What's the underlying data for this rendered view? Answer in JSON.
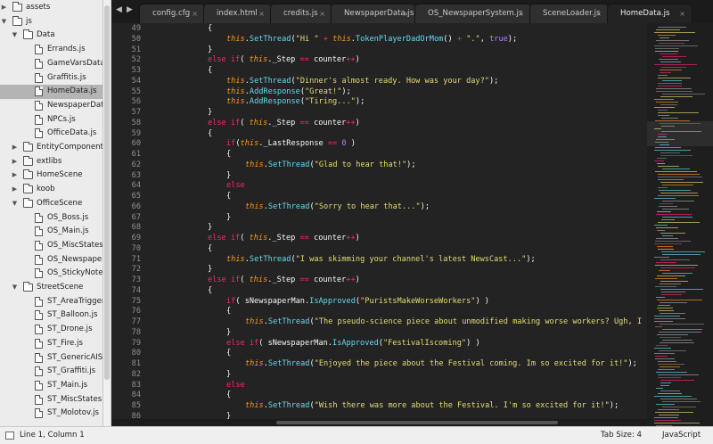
{
  "sidebar": {
    "items": [
      {
        "label": "assets",
        "type": "folder",
        "depth": 0,
        "open": false
      },
      {
        "label": "js",
        "type": "folder",
        "depth": 0,
        "open": true
      },
      {
        "label": "Data",
        "type": "folder",
        "depth": 1,
        "open": true
      },
      {
        "label": "Errands.js",
        "type": "file",
        "depth": 2
      },
      {
        "label": "GameVarsData",
        "type": "file",
        "depth": 2
      },
      {
        "label": "Graffitis.js",
        "type": "file",
        "depth": 2
      },
      {
        "label": "HomeData.js",
        "type": "file",
        "depth": 2,
        "selected": true
      },
      {
        "label": "NewspaperDat",
        "type": "file",
        "depth": 2
      },
      {
        "label": "NPCs.js",
        "type": "file",
        "depth": 2
      },
      {
        "label": "OfficeData.js",
        "type": "file",
        "depth": 2
      },
      {
        "label": "EntityComponent",
        "type": "folder",
        "depth": 1,
        "open": false
      },
      {
        "label": "extlibs",
        "type": "folder",
        "depth": 1,
        "open": false
      },
      {
        "label": "HomeScene",
        "type": "folder",
        "depth": 1,
        "open": false
      },
      {
        "label": "koob",
        "type": "folder",
        "depth": 1,
        "open": false
      },
      {
        "label": "OfficeScene",
        "type": "folder",
        "depth": 1,
        "open": true
      },
      {
        "label": "OS_Boss.js",
        "type": "file",
        "depth": 2
      },
      {
        "label": "OS_Main.js",
        "type": "file",
        "depth": 2
      },
      {
        "label": "OS_MiscStates.j",
        "type": "file",
        "depth": 2
      },
      {
        "label": "OS_Newspaper",
        "type": "file",
        "depth": 2
      },
      {
        "label": "OS_StickyNote",
        "type": "file",
        "depth": 2
      },
      {
        "label": "StreetScene",
        "type": "folder",
        "depth": 1,
        "open": true
      },
      {
        "label": "ST_AreaTrigger",
        "type": "file",
        "depth": 2
      },
      {
        "label": "ST_Balloon.js",
        "type": "file",
        "depth": 2
      },
      {
        "label": "ST_Drone.js",
        "type": "file",
        "depth": 2
      },
      {
        "label": "ST_Fire.js",
        "type": "file",
        "depth": 2
      },
      {
        "label": "ST_GenericAISt",
        "type": "file",
        "depth": 2
      },
      {
        "label": "ST_Graffiti.js",
        "type": "file",
        "depth": 2
      },
      {
        "label": "ST_Main.js",
        "type": "file",
        "depth": 2
      },
      {
        "label": "ST_MiscStates.j",
        "type": "file",
        "depth": 2
      },
      {
        "label": "ST_Molotov.js",
        "type": "file",
        "depth": 2
      }
    ]
  },
  "tabs": [
    {
      "label": "config.cfg",
      "active": false
    },
    {
      "label": "index.html",
      "active": false
    },
    {
      "label": "credits.js",
      "active": false
    },
    {
      "label": "NewspaperData.js",
      "active": false
    },
    {
      "label": "OS_NewspaperSystem.js",
      "active": false
    },
    {
      "label": "SceneLoader.js",
      "active": false
    },
    {
      "label": "HomeData.js",
      "active": true
    }
  ],
  "tab_close_glyph": "×",
  "nav": {
    "back": "◀",
    "forward": "▶"
  },
  "editor": {
    "lines": [
      {
        "n": "49",
        "indent": 0,
        "t": [
          [
            "p",
            "{"
          ]
        ]
      },
      {
        "n": "50",
        "indent": 1,
        "t": [
          [
            "th",
            "this"
          ],
          [
            "p",
            "."
          ],
          [
            "fn",
            "SetThread"
          ],
          [
            "p",
            "("
          ],
          [
            "st",
            "\"Hi \""
          ],
          [
            "p",
            " "
          ],
          [
            "op",
            "+"
          ],
          [
            "p",
            " "
          ],
          [
            "th",
            "this"
          ],
          [
            "p",
            "."
          ],
          [
            "fn",
            "TokenPlayerDadOrMom"
          ],
          [
            "p",
            "() "
          ],
          [
            "op",
            "+"
          ],
          [
            "p",
            " "
          ],
          [
            "st",
            "\".\""
          ],
          [
            "p",
            ", "
          ],
          [
            "nm",
            "true"
          ],
          [
            "p",
            ");"
          ]
        ]
      },
      {
        "n": "51",
        "indent": 0,
        "t": [
          [
            "p",
            "}"
          ]
        ]
      },
      {
        "n": "52",
        "indent": 0,
        "t": [
          [
            "kw",
            "else if"
          ],
          [
            "p",
            "( "
          ],
          [
            "th",
            "this"
          ],
          [
            "p",
            "._Step "
          ],
          [
            "op",
            "=="
          ],
          [
            "p",
            " counter"
          ],
          [
            "op",
            "++"
          ],
          [
            "p",
            ")"
          ]
        ]
      },
      {
        "n": "53",
        "indent": 0,
        "t": [
          [
            "p",
            "{"
          ]
        ]
      },
      {
        "n": "54",
        "indent": 1,
        "t": [
          [
            "th",
            "this"
          ],
          [
            "p",
            "."
          ],
          [
            "fn",
            "SetThread"
          ],
          [
            "p",
            "("
          ],
          [
            "st",
            "\"Dinner's almost ready. How was your day?\""
          ],
          [
            "p",
            ");"
          ]
        ]
      },
      {
        "n": "55",
        "indent": 1,
        "t": [
          [
            "th",
            "this"
          ],
          [
            "p",
            "."
          ],
          [
            "fn",
            "AddResponse"
          ],
          [
            "p",
            "("
          ],
          [
            "st",
            "\"Great!\""
          ],
          [
            "p",
            ");"
          ]
        ]
      },
      {
        "n": "56",
        "indent": 1,
        "t": [
          [
            "th",
            "this"
          ],
          [
            "p",
            "."
          ],
          [
            "fn",
            "AddResponse"
          ],
          [
            "p",
            "("
          ],
          [
            "st",
            "\"Tiring...\""
          ],
          [
            "p",
            ");"
          ]
        ]
      },
      {
        "n": "57",
        "indent": 0,
        "t": [
          [
            "p",
            "}"
          ]
        ]
      },
      {
        "n": "58",
        "indent": 0,
        "t": [
          [
            "kw",
            "else if"
          ],
          [
            "p",
            "( "
          ],
          [
            "th",
            "this"
          ],
          [
            "p",
            "._Step "
          ],
          [
            "op",
            "=="
          ],
          [
            "p",
            " counter"
          ],
          [
            "op",
            "++"
          ],
          [
            "p",
            ")"
          ]
        ]
      },
      {
        "n": "59",
        "indent": 0,
        "t": [
          [
            "p",
            "{"
          ]
        ]
      },
      {
        "n": "60",
        "indent": 1,
        "t": [
          [
            "kw",
            "if"
          ],
          [
            "p",
            "("
          ],
          [
            "th",
            "this"
          ],
          [
            "p",
            "._LastResponse "
          ],
          [
            "op",
            "=="
          ],
          [
            "p",
            " "
          ],
          [
            "nm",
            "0"
          ],
          [
            "p",
            " )"
          ]
        ]
      },
      {
        "n": "61",
        "indent": 1,
        "t": [
          [
            "p",
            "{"
          ]
        ]
      },
      {
        "n": "62",
        "indent": 2,
        "t": [
          [
            "th",
            "this"
          ],
          [
            "p",
            "."
          ],
          [
            "fn",
            "SetThread"
          ],
          [
            "p",
            "("
          ],
          [
            "st",
            "\"Glad to hear that!\""
          ],
          [
            "p",
            ");"
          ]
        ]
      },
      {
        "n": "63",
        "indent": 1,
        "t": [
          [
            "p",
            "}"
          ]
        ]
      },
      {
        "n": "64",
        "indent": 1,
        "t": [
          [
            "kw",
            "else"
          ]
        ]
      },
      {
        "n": "65",
        "indent": 1,
        "t": [
          [
            "p",
            "{"
          ]
        ]
      },
      {
        "n": "66",
        "indent": 2,
        "t": [
          [
            "th",
            "this"
          ],
          [
            "p",
            "."
          ],
          [
            "fn",
            "SetThread"
          ],
          [
            "p",
            "("
          ],
          [
            "st",
            "\"Sorry to hear that...\""
          ],
          [
            "p",
            ");"
          ]
        ]
      },
      {
        "n": "67",
        "indent": 1,
        "t": [
          [
            "p",
            "}"
          ]
        ]
      },
      {
        "n": "68",
        "indent": 0,
        "t": [
          [
            "p",
            "}"
          ]
        ]
      },
      {
        "n": "69",
        "indent": 0,
        "t": [
          [
            "kw",
            "else if"
          ],
          [
            "p",
            "( "
          ],
          [
            "th",
            "this"
          ],
          [
            "p",
            "._Step "
          ],
          [
            "op",
            "=="
          ],
          [
            "p",
            " counter"
          ],
          [
            "op",
            "++"
          ],
          [
            "p",
            ")"
          ]
        ]
      },
      {
        "n": "70",
        "indent": 0,
        "t": [
          [
            "p",
            "{"
          ]
        ]
      },
      {
        "n": "71",
        "indent": 1,
        "t": [
          [
            "th",
            "this"
          ],
          [
            "p",
            "."
          ],
          [
            "fn",
            "SetThread"
          ],
          [
            "p",
            "("
          ],
          [
            "st",
            "\"I was skimming your channel's latest NewsCast...\""
          ],
          [
            "p",
            ");"
          ]
        ]
      },
      {
        "n": "72",
        "indent": 0,
        "t": [
          [
            "p",
            "}"
          ]
        ]
      },
      {
        "n": "73",
        "indent": 0,
        "t": [
          [
            "kw",
            "else if"
          ],
          [
            "p",
            "( "
          ],
          [
            "th",
            "this"
          ],
          [
            "p",
            "._Step "
          ],
          [
            "op",
            "=="
          ],
          [
            "p",
            " counter"
          ],
          [
            "op",
            "++"
          ],
          [
            "p",
            ")"
          ]
        ]
      },
      {
        "n": "74",
        "indent": 0,
        "t": [
          [
            "p",
            "{"
          ]
        ]
      },
      {
        "n": "75",
        "indent": 1,
        "t": [
          [
            "kw",
            "if"
          ],
          [
            "p",
            "( sNewspaperMan."
          ],
          [
            "fn",
            "IsApproved"
          ],
          [
            "p",
            "("
          ],
          [
            "st",
            "\"PuristsMakeWorseWorkers\""
          ],
          [
            "p",
            ") )"
          ]
        ]
      },
      {
        "n": "76",
        "indent": 1,
        "t": [
          [
            "p",
            "{"
          ]
        ]
      },
      {
        "n": "77",
        "indent": 2,
        "t": [
          [
            "th",
            "this"
          ],
          [
            "p",
            "."
          ],
          [
            "fn",
            "SetThread"
          ],
          [
            "p",
            "("
          ],
          [
            "st",
            "\"The pseudo-science piece about unmodified making worse workers? Ugh, I c"
          ]
        ]
      },
      {
        "n": "78",
        "indent": 1,
        "t": [
          [
            "p",
            "}"
          ]
        ]
      },
      {
        "n": "79",
        "indent": 1,
        "t": [
          [
            "kw",
            "else if"
          ],
          [
            "p",
            "( sNewspaperMan."
          ],
          [
            "fn",
            "IsApproved"
          ],
          [
            "p",
            "("
          ],
          [
            "st",
            "\"FestivalIscoming\""
          ],
          [
            "p",
            ") )"
          ]
        ]
      },
      {
        "n": "80",
        "indent": 1,
        "t": [
          [
            "p",
            "{"
          ]
        ]
      },
      {
        "n": "81",
        "indent": 2,
        "t": [
          [
            "th",
            "this"
          ],
          [
            "p",
            "."
          ],
          [
            "fn",
            "SetThread"
          ],
          [
            "p",
            "("
          ],
          [
            "st",
            "\"Enjoyed the piece about the Festival coming. Im so excited for it!\""
          ],
          [
            "p",
            ");"
          ]
        ]
      },
      {
        "n": "82",
        "indent": 1,
        "t": [
          [
            "p",
            "}"
          ]
        ]
      },
      {
        "n": "83",
        "indent": 1,
        "t": [
          [
            "kw",
            "else"
          ]
        ]
      },
      {
        "n": "84",
        "indent": 1,
        "t": [
          [
            "p",
            "{"
          ]
        ]
      },
      {
        "n": "85",
        "indent": 2,
        "t": [
          [
            "th",
            "this"
          ],
          [
            "p",
            "."
          ],
          [
            "fn",
            "SetThread"
          ],
          [
            "p",
            "("
          ],
          [
            "st",
            "\"Wish there was more about the Festival. I'm so excited for it!\""
          ],
          [
            "p",
            ");"
          ]
        ]
      },
      {
        "n": "86",
        "indent": 1,
        "t": [
          [
            "p",
            "}"
          ]
        ]
      }
    ]
  },
  "status": {
    "position": "Line 1, Column 1",
    "tab_size": "Tab Size: 4",
    "syntax": "JavaScript"
  },
  "colors": {
    "keyword": "#f92672",
    "this": "#fd971f",
    "function": "#66d9ef",
    "string": "#e6db74",
    "number": "#ae81ff",
    "plain": "#f8f8f2",
    "line_number": "#8f8f8f",
    "background": "#232323"
  }
}
